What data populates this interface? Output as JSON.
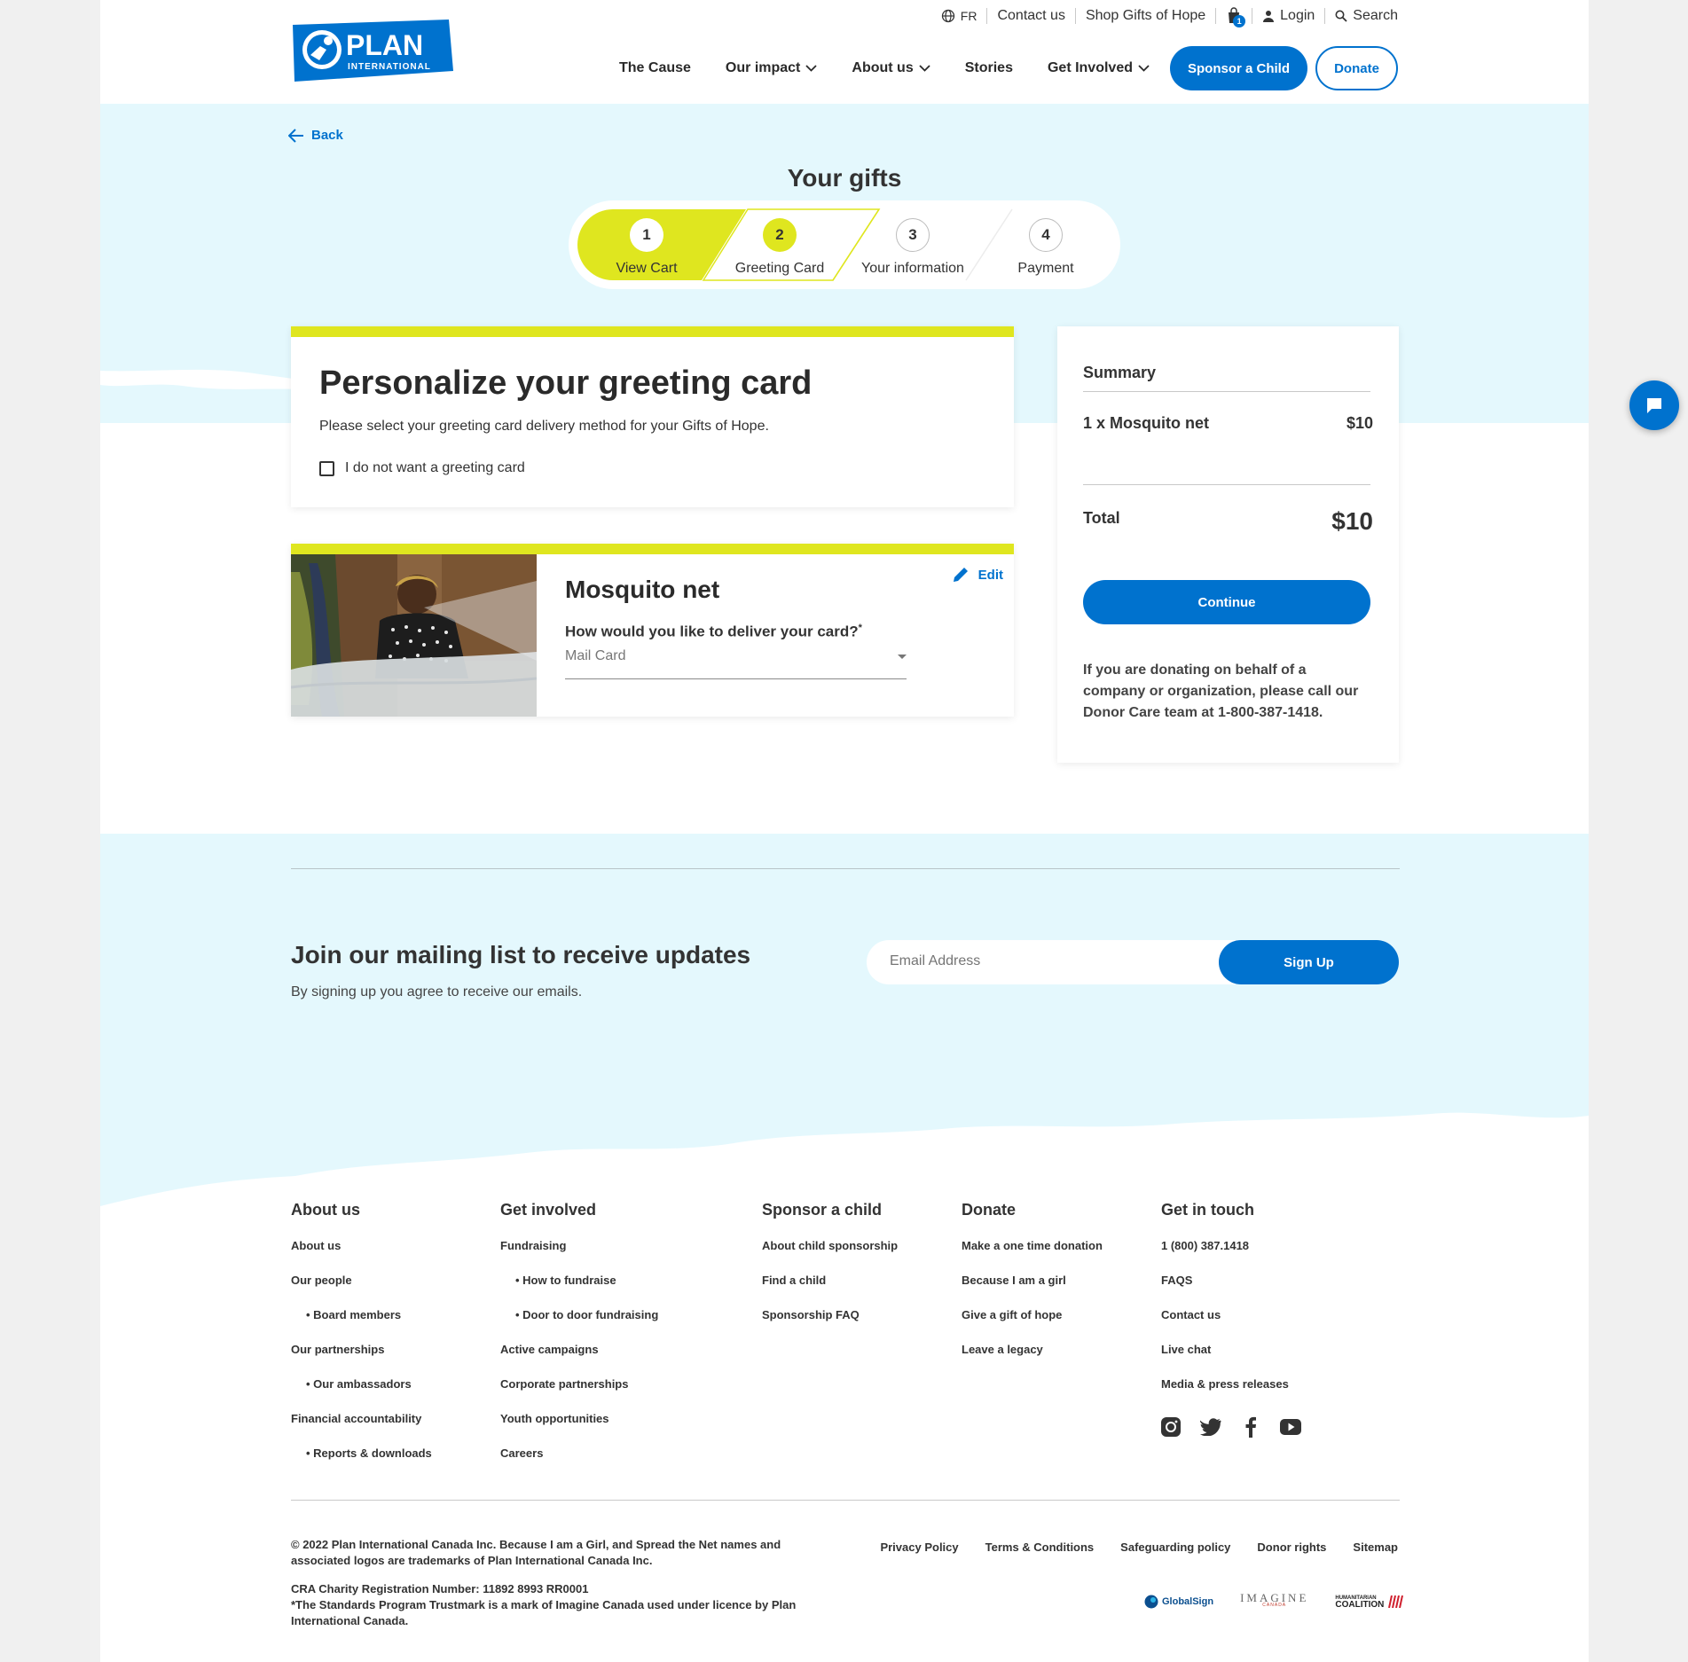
{
  "colors": {
    "primary": "#0072ce",
    "accent_yellow": "#dfe61f",
    "light_blue": "#e4f8fd"
  },
  "header": {
    "logo": {
      "line1": "PLAN",
      "line2": "INTERNATIONAL"
    },
    "utility": {
      "language": "FR",
      "contact": "Contact us",
      "shop": "Shop Gifts of Hope",
      "cart_count": "1",
      "login": "Login",
      "search": "Search"
    },
    "nav": [
      "The Cause",
      "Our impact",
      "About us",
      "Stories",
      "Get Involved"
    ],
    "sponsor_label": "Sponsor a Child",
    "donate_label": "Donate"
  },
  "back_label": "Back",
  "page_title": "Your gifts",
  "stepper": [
    {
      "num": "1",
      "label": "View Cart",
      "state": "done"
    },
    {
      "num": "2",
      "label": "Greeting Card",
      "state": "current"
    },
    {
      "num": "3",
      "label": "Your information",
      "state": "todo"
    },
    {
      "num": "4",
      "label": "Payment",
      "state": "todo"
    }
  ],
  "greeting": {
    "title": "Personalize your greeting card",
    "subtitle": "Please select your greeting card delivery method for your Gifts of Hope.",
    "no_card_label": "I do not want a greeting card"
  },
  "gift": {
    "name": "Mosquito net",
    "edit_label": "Edit",
    "question": "How would you like to deliver your card?",
    "required_mark": "*",
    "selected_option": "Mail Card"
  },
  "summary": {
    "title": "Summary",
    "item_label": "1 x Mosquito net",
    "item_price": "$10",
    "total_label": "Total",
    "total_value": "$10",
    "continue_label": "Continue",
    "note": "If you are donating on behalf of a company or organization, please call our Donor Care team at 1-800-387-1418."
  },
  "mailing": {
    "title": "Join our mailing list to receive updates",
    "subtitle": "By signing up you agree to receive our emails.",
    "email_placeholder": "Email Address",
    "signup_label": "Sign Up"
  },
  "footer": {
    "about": {
      "title": "About us",
      "links": [
        "About us",
        "Our people",
        "• Board members",
        "Our partnerships",
        "• Our ambassadors",
        "Financial accountability",
        "• Reports & downloads"
      ]
    },
    "involved": {
      "title": "Get involved",
      "links": [
        "Fundraising",
        "• How to fundraise",
        "• Door to door fundraising",
        "Active campaigns",
        "Corporate partnerships",
        "Youth opportunities",
        "Careers"
      ]
    },
    "sponsor": {
      "title": "Sponsor a child",
      "links": [
        "About child sponsorship",
        "Find a child",
        "Sponsorship FAQ"
      ]
    },
    "donate": {
      "title": "Donate",
      "links": [
        "Make a one time donation",
        "Because I am a girl",
        "Give a gift of hope",
        "Leave a legacy"
      ]
    },
    "contact": {
      "title": "Get in touch",
      "links": [
        "1 (800) 387.1418",
        "FAQS",
        "Contact us",
        "Live chat",
        "Media & press releases"
      ]
    },
    "social": [
      "instagram-icon",
      "twitter-icon",
      "facebook-icon",
      "youtube-icon"
    ],
    "copyright": "© 2022 Plan International Canada Inc. Because I am a Girl, and Spread the Net names and associated logos are trademarks of Plan International Canada Inc.",
    "cra": "CRA Charity Registration Number: 11892 8993 RR0001",
    "trustmark": "*The Standards Program Trustmark is a mark of Imagine Canada used under licence by Plan International Canada.",
    "legal": [
      "Privacy Policy",
      "Terms & Conditions",
      "Safeguarding policy",
      "Donor rights",
      "Sitemap"
    ],
    "badges": {
      "globalsign": "GlobalSign",
      "imagine": "IMAGINE",
      "imagine_sub": "CANADA",
      "humanitarian_top": "HUMANITARIAN",
      "humanitarian_bottom": "COALITION"
    }
  }
}
